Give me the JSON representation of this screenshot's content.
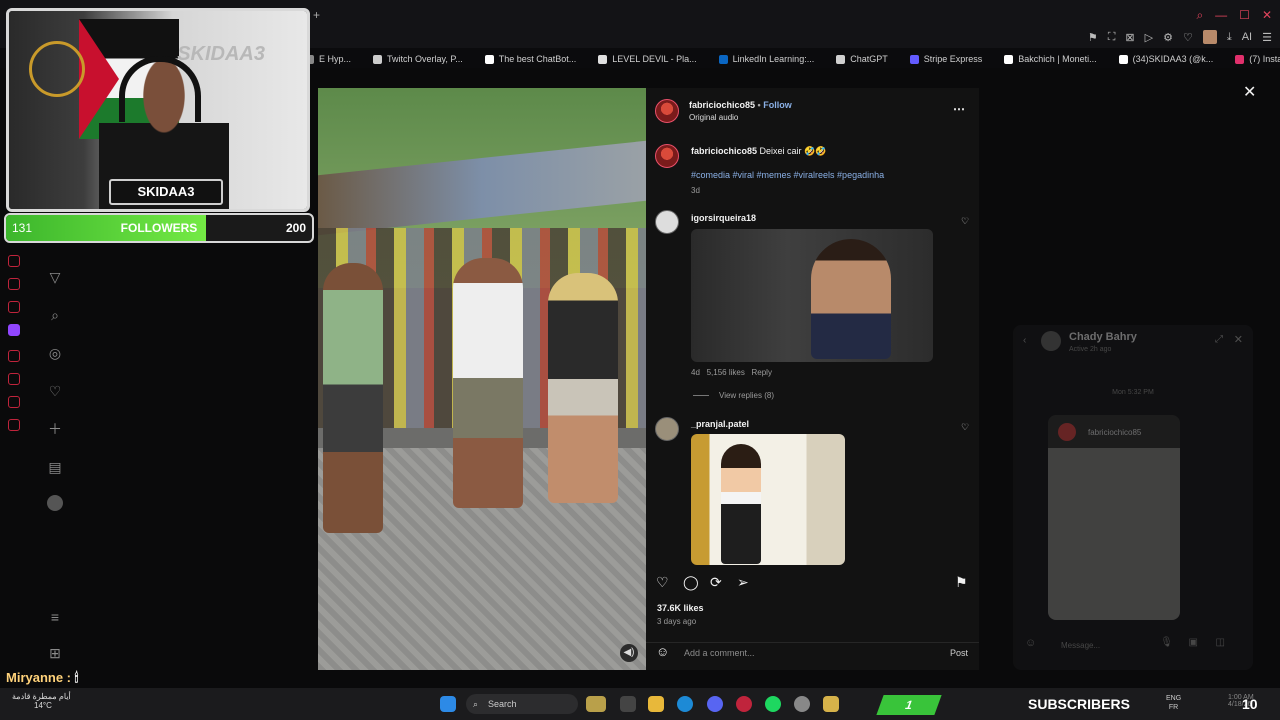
{
  "browser": {
    "new_tab_glyph": "+",
    "bookmarks": [
      {
        "label": "E Hyp...",
        "color": "#888888"
      },
      {
        "label": "Twitch Overlay, P...",
        "color": "#cccccc"
      },
      {
        "label": "The best ChatBot...",
        "color": "#ffffff"
      },
      {
        "label": "LEVEL DEVIL - Pla...",
        "color": "#e0e0e0"
      },
      {
        "label": "LinkedIn Learning:...",
        "color": "#0a66c2"
      },
      {
        "label": "ChatGPT",
        "color": "#d0d0d0"
      },
      {
        "label": "Stripe Express",
        "color": "#635bff"
      },
      {
        "label": "Bakchich | Moneti...",
        "color": "#ffffff"
      },
      {
        "label": "(34)SKIDAA3 (@k...",
        "color": "#ffffff"
      },
      {
        "label": "(7) Instagram",
        "color": "#e1306c"
      }
    ],
    "ai_label": "AI"
  },
  "stream_overlay": {
    "nameplate": "SKIDAA3",
    "wall_text": "SKIDAA3",
    "followers": {
      "current": "131",
      "label": "FOLLOWERS",
      "goal": "200",
      "progress": 0.655
    },
    "chat_user": "Miryanne :",
    "subscribers_label": "SUBSCRIBERS",
    "subscribers_count": "10",
    "subscribers_badge": "1"
  },
  "post": {
    "author": "fabriciochico85",
    "follow_label": "Follow",
    "audio": "Original audio",
    "caption_author": "fabriciochico85",
    "caption": "Deixei cair 🤣🤣",
    "hashtags": "#comedia #viral #memes #viralreels #pegadinha",
    "caption_age": "3d",
    "comments": [
      {
        "user": "igorsirqueira18",
        "age": "4d",
        "likes": "5,156 likes",
        "reply": "Reply",
        "view_replies": "View replies (8)"
      },
      {
        "user": "_pranjal.patel"
      }
    ],
    "likes": "37.6K likes",
    "posted": "3 days ago",
    "comment_placeholder": "Add a comment...",
    "post_button": "Post"
  },
  "messenger": {
    "contact": "Chady Bahry",
    "status": "Active 2h ago",
    "timestamp": "Mon 5:32 PM",
    "shared_author": "fabriciochico85",
    "message_placeholder": "Message..."
  },
  "taskbar": {
    "weather_text": "أيام ممطرة قادمة",
    "temperature": "14°C",
    "search_label": "Search",
    "lang_top": "ENG",
    "lang_bottom": "FR",
    "time": "1:00 AM",
    "date": "4/18/26"
  },
  "colors": {
    "follow": "#8ab0e6",
    "followers_bar": "#5ad23a",
    "accent_red": "#e0445c"
  }
}
